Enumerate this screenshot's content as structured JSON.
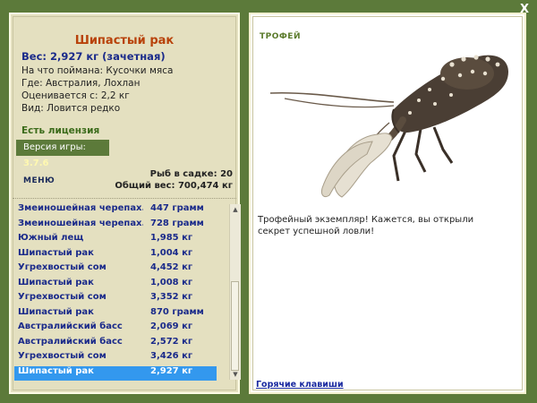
{
  "window": {
    "close_label": "X"
  },
  "fish": {
    "title": "Шипастый рак",
    "weight": "Вес: 2,927 кг (зачетная)",
    "bait": "На что поймана: Кусочки мяса",
    "location": "Где: Австралия, Лохлан",
    "value": "Оценивается с: 2,2 кг",
    "kind": "Вид: Ловится редко"
  },
  "license": "Есть лицензия",
  "version": {
    "label": "Версия игры:",
    "value": "3.7.6"
  },
  "menu_label": "МЕНЮ",
  "stats": {
    "fish_in_keepnet": "Рыб в садке: 20",
    "total_weight": "Общий вес: 700,474 кг"
  },
  "catch_list": [
    {
      "name": "Змеиношейная черепах...",
      "weight": "447 грамм"
    },
    {
      "name": "Змеиношейная черепах...",
      "weight": "728 грамм"
    },
    {
      "name": "Южный лещ",
      "weight": "1,985 кг"
    },
    {
      "name": "Шипастый рак",
      "weight": "1,004 кг"
    },
    {
      "name": "Угрехвостый сом",
      "weight": "4,452 кг"
    },
    {
      "name": "Шипастый рак",
      "weight": "1,008 кг"
    },
    {
      "name": "Угрехвостый сом",
      "weight": "3,352 кг"
    },
    {
      "name": "Шипастый рак",
      "weight": "870 грамм"
    },
    {
      "name": "Австралийский басс",
      "weight": "2,069 кг"
    },
    {
      "name": "Австралийский басс",
      "weight": "2,572 кг"
    },
    {
      "name": "Угрехвостый сом",
      "weight": "3,426 кг"
    },
    {
      "name": "Шипастый рак",
      "weight": "2,927 кг"
    }
  ],
  "selected_index": 11,
  "trophy": {
    "label": "ТРОФЕЙ",
    "text": "Трофейный экземпляр! Кажется, вы открыли секрет успешной ловли!"
  },
  "hotkeys_label": "Горячие клавиши",
  "colors": {
    "frame": "#5c7a3a",
    "panel": "#e4e0c0",
    "selection": "#3398ee",
    "title": "#b8420a",
    "list_text": "#1a2a8a"
  }
}
